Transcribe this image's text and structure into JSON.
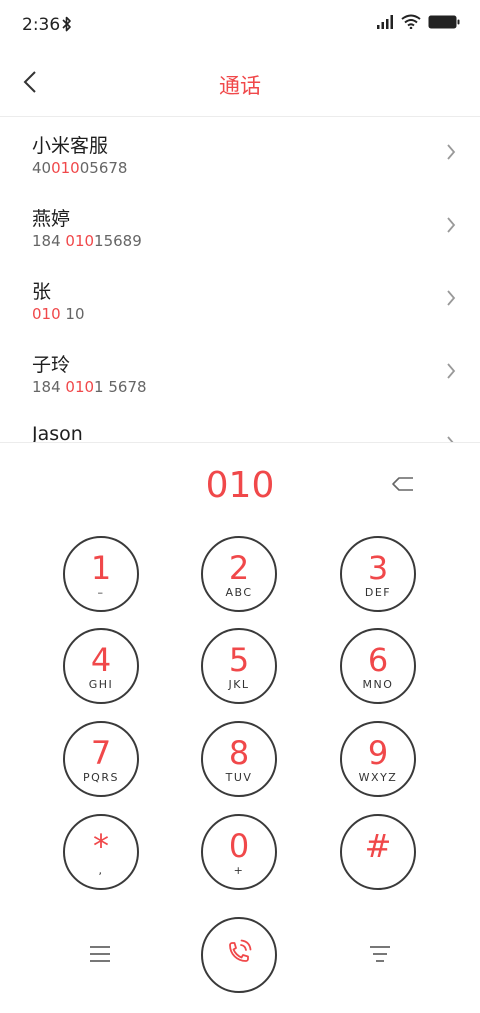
{
  "status_bar": {
    "time": "2:36",
    "icons": [
      "bluetooth-icon",
      "signal-icon",
      "wifi-icon",
      "battery-icon"
    ]
  },
  "header": {
    "title": "通话",
    "back_icon": "back-arrow-icon"
  },
  "contacts": [
    {
      "name": "小米客服",
      "number_parts": [
        "40",
        "010",
        "05678"
      ]
    },
    {
      "name": "燕婷",
      "number_parts": [
        "184 ",
        "010",
        "15689"
      ]
    },
    {
      "name": "张",
      "number_parts": [
        "",
        "010",
        " 10"
      ]
    },
    {
      "name": "子玲",
      "number_parts": [
        "184 ",
        "010",
        "1 5678"
      ]
    },
    {
      "name": "Jason",
      "number_parts": [
        "",
        "",
        ""
      ]
    }
  ],
  "dialer": {
    "input": "010",
    "backspace_icon": "backspace-icon"
  },
  "keypad": [
    {
      "digit": "1",
      "letters": "–"
    },
    {
      "digit": "2",
      "letters": "ABC"
    },
    {
      "digit": "3",
      "letters": "DEF"
    },
    {
      "digit": "4",
      "letters": "GHI"
    },
    {
      "digit": "5",
      "letters": "JKL"
    },
    {
      "digit": "6",
      "letters": "MNO"
    },
    {
      "digit": "7",
      "letters": "PQRS"
    },
    {
      "digit": "8",
      "letters": "TUV"
    },
    {
      "digit": "9",
      "letters": "WXYZ"
    },
    {
      "digit": "*",
      "letters": ","
    },
    {
      "digit": "0",
      "letters": "+"
    },
    {
      "digit": "#",
      "letters": ""
    }
  ],
  "bottom_bar": {
    "left_icon": "menu-icon",
    "call_icon": "phone-call-icon",
    "right_icon": "more-icon"
  },
  "colors": {
    "accent": "#f0484a",
    "text": "#1e1e1e",
    "secondary_text": "#666666",
    "key_border": "#3a3a3a"
  }
}
